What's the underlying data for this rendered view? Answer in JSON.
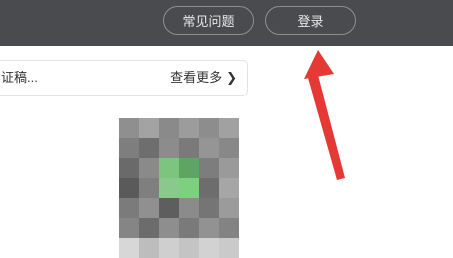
{
  "header": {
    "faq_label": "常见问题",
    "login_label": "登录"
  },
  "notice": {
    "text": "证稿...",
    "more_label": "查看更多",
    "more_icon": "chevron-right-icon"
  },
  "colors": {
    "topbar": "#4a4b4e",
    "annotation_arrow": "#e53935"
  }
}
